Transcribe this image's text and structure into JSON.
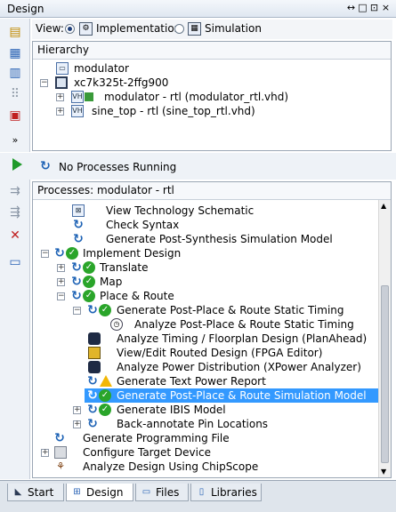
{
  "window": {
    "title": "Design",
    "controls": [
      "↔",
      "□",
      "⊡",
      "×"
    ]
  },
  "view": {
    "label": "View:",
    "options": [
      {
        "label": "Implementation",
        "selected": true
      },
      {
        "label": "Simulation",
        "selected": false
      }
    ]
  },
  "hierarchy": {
    "header": "Hierarchy",
    "items": [
      {
        "label": "modulator"
      },
      {
        "label": "xc7k325t-2ffg900"
      },
      {
        "label": "modulator - rtl (modulator_rtl.vhd)"
      },
      {
        "label": "sine_top - rtl (sine_top_rtl.vhd)"
      }
    ]
  },
  "status": {
    "text": "No Processes Running"
  },
  "processes": {
    "header": "Processes: modulator - rtl",
    "items": [
      {
        "label": "View Technology Schematic"
      },
      {
        "label": "Check Syntax"
      },
      {
        "label": "Generate Post-Synthesis Simulation Model"
      },
      {
        "label": "Implement Design"
      },
      {
        "label": "Translate"
      },
      {
        "label": "Map"
      },
      {
        "label": "Place & Route"
      },
      {
        "label": "Generate Post-Place & Route Static Timing"
      },
      {
        "label": "Analyze Post-Place & Route Static Timing"
      },
      {
        "label": "Analyze Timing / Floorplan Design (PlanAhead)"
      },
      {
        "label": "View/Edit Routed Design (FPGA Editor)"
      },
      {
        "label": "Analyze Power Distribution (XPower Analyzer)"
      },
      {
        "label": "Generate Text Power Report"
      },
      {
        "label": "Generate Post-Place & Route Simulation Model"
      },
      {
        "label": "Generate IBIS Model"
      },
      {
        "label": "Back-annotate Pin Locations"
      },
      {
        "label": "Generate Programming File"
      },
      {
        "label": "Configure Target Device"
      },
      {
        "label": "Analyze Design Using ChipScope"
      }
    ]
  },
  "tabs": [
    {
      "label": "Start"
    },
    {
      "label": "Design"
    },
    {
      "label": "Files"
    },
    {
      "label": "Libraries"
    }
  ],
  "colors": {
    "selection": "#3399ff",
    "ok": "#2aa52a",
    "warning": "#f2b705",
    "run": "#1d62b5"
  }
}
